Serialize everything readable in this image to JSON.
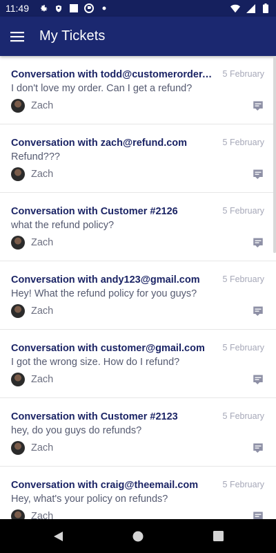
{
  "status_bar": {
    "time": "11:49",
    "icons_left": [
      "gear-icon",
      "shield-icon",
      "square-icon",
      "target-icon",
      "dot-icon"
    ],
    "icons_right": [
      "wifi-icon",
      "signal-icon",
      "battery-icon"
    ]
  },
  "app_bar": {
    "title": "My Tickets",
    "color": "#1b2870"
  },
  "tickets": [
    {
      "title": "Conversation with todd@customerorder.com",
      "date": "5 February",
      "message": "I don't love my order. Can I get a refund?",
      "agent": "Zach"
    },
    {
      "title": "Conversation with zach@refund.com",
      "date": "5 February",
      "message": "Refund???",
      "agent": "Zach"
    },
    {
      "title": "Conversation with Customer #2126",
      "date": "5 February",
      "message": "what the refund policy?",
      "agent": "Zach"
    },
    {
      "title": "Conversation with andy123@gmail.com",
      "date": "5 February",
      "message": "Hey! What the refund policy for you guys?",
      "agent": "Zach"
    },
    {
      "title": "Conversation with customer@gmail.com",
      "date": "5 February",
      "message": "I got the wrong size. How do I refund?",
      "agent": "Zach"
    },
    {
      "title": "Conversation with Customer #2123",
      "date": "5 February",
      "message": "hey, do you guys do refunds?",
      "agent": "Zach"
    },
    {
      "title": "Conversation with craig@theemail.com",
      "date": "5 February",
      "message": "Hey, what's your policy on refunds?",
      "agent": "Zach"
    }
  ],
  "nav_bar": {
    "buttons": [
      "back-icon",
      "home-icon",
      "recents-icon"
    ]
  }
}
